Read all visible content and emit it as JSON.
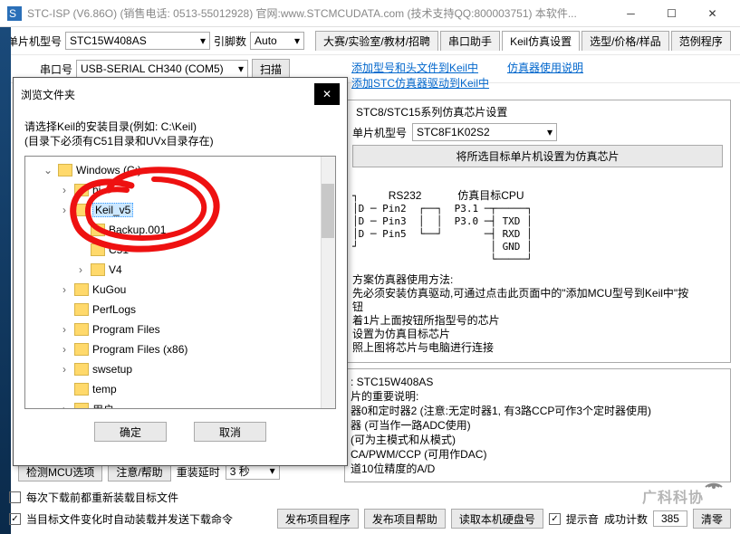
{
  "window": {
    "title": "STC-ISP (V6.86O) (销售电话: 0513-55012928) 官网:www.STCMCUDATA.com (技术支持QQ:800003751) 本软件..."
  },
  "toolbar": {
    "mcu_label": "单片机型号",
    "mcu_value": "STC15W408AS",
    "pin_label": "引脚数",
    "pin_value": "Auto",
    "tabs": [
      "大赛/实验室/教材/招聘",
      "串口助手",
      "Keil仿真设置",
      "选型/价格/样品",
      "范例程序"
    ]
  },
  "row2": {
    "port_label": "串口号",
    "port_value": "USB-SERIAL CH340 (COM5)",
    "scan": "扫描"
  },
  "links": {
    "a": "添加型号和头文件到Keil中\n添加STC仿真器驱动到Keil中",
    "b": "仿真器使用说明"
  },
  "sim_group": {
    "legend": "STC8/STC15系列仿真芯片设置",
    "model_label": "单片机型号",
    "model_value": "STC8F1K02S2",
    "set_btn": "将所选目标单片机设置为仿真芯片",
    "rs232": "RS232",
    "target": "仿真目标CPU",
    "pins_left": [
      "Pin2",
      "Pin3",
      "Pin5"
    ],
    "pins_right": [
      "P3.1",
      "P3.0",
      ""
    ],
    "pins_box": [
      "TXD",
      "RXD",
      "GND"
    ],
    "usage": "方案仿真器使用方法:\n先必须安装仿真驱动,可通过点击此页面中的\"添加MCU型号到Keil中\"按\n钮\n着1片上面按钮所指型号的芯片\n设置为仿真目标芯片\n照上图将芯片与电脑进行连接"
  },
  "chip_info": {
    "title": ": STC15W408AS",
    "body": "片的重要说明:\n器0和定时器2 (注意:无定时器1, 有3路CCP可作3个定时器使用)\n器 (可当作一路ADC使用)\n(可为主模式和从模式)\nCA/PWM/CCP (可用作DAC)\n道10位精度的A/D"
  },
  "dialog": {
    "title": "浏览文件夹",
    "hint1": "请选择Keil的安装目录(例如: C:\\Keil)",
    "hint2": "(目录下必须有C51目录和UVx目录存在)",
    "ok": "确定",
    "cancel": "取消",
    "tree": [
      {
        "label": "Windows (C:)",
        "indent": 1,
        "chev": "v",
        "selected": false,
        "type": "drive"
      },
      {
        "label": "       hi",
        "indent": 2,
        "chev": ">",
        "selected": false
      },
      {
        "label": "Keil_v5",
        "indent": 2,
        "chev": ">",
        "selected": true
      },
      {
        "label": "Backup.001",
        "indent": 3,
        "chev": "",
        "selected": false
      },
      {
        "label": "C51",
        "indent": 3,
        "chev": "",
        "selected": false
      },
      {
        "label": "   V4",
        "indent": 3,
        "chev": ">",
        "selected": false
      },
      {
        "label": "KuGou",
        "indent": 2,
        "chev": ">",
        "selected": false
      },
      {
        "label": "PerfLogs",
        "indent": 2,
        "chev": "",
        "selected": false
      },
      {
        "label": "Program Files",
        "indent": 2,
        "chev": ">",
        "selected": false
      },
      {
        "label": "Program Files (x86)",
        "indent": 2,
        "chev": ">",
        "selected": false
      },
      {
        "label": "swsetup",
        "indent": 2,
        "chev": ">",
        "selected": false
      },
      {
        "label": "temp",
        "indent": 2,
        "chev": "",
        "selected": false
      },
      {
        "label": "用户",
        "indent": 2,
        "chev": ">",
        "selected": false
      }
    ]
  },
  "bottom_left": {
    "btn1": "检测MCU选项",
    "btn2": "注意/帮助",
    "lbl3": "重装延时",
    "val3": "3 秒"
  },
  "bottom": {
    "chk1": "每次下载前都重新装载目标文件",
    "chk2": "当目标文件变化时自动装载并发送下载命令",
    "b1": "发布项目程序",
    "b2": "发布项目帮助",
    "b3": "读取本机硬盘号",
    "b4": "提示音",
    "lbl_count": "成功计数",
    "count": "385",
    "b5": "清零"
  },
  "watermark": "广科科协"
}
